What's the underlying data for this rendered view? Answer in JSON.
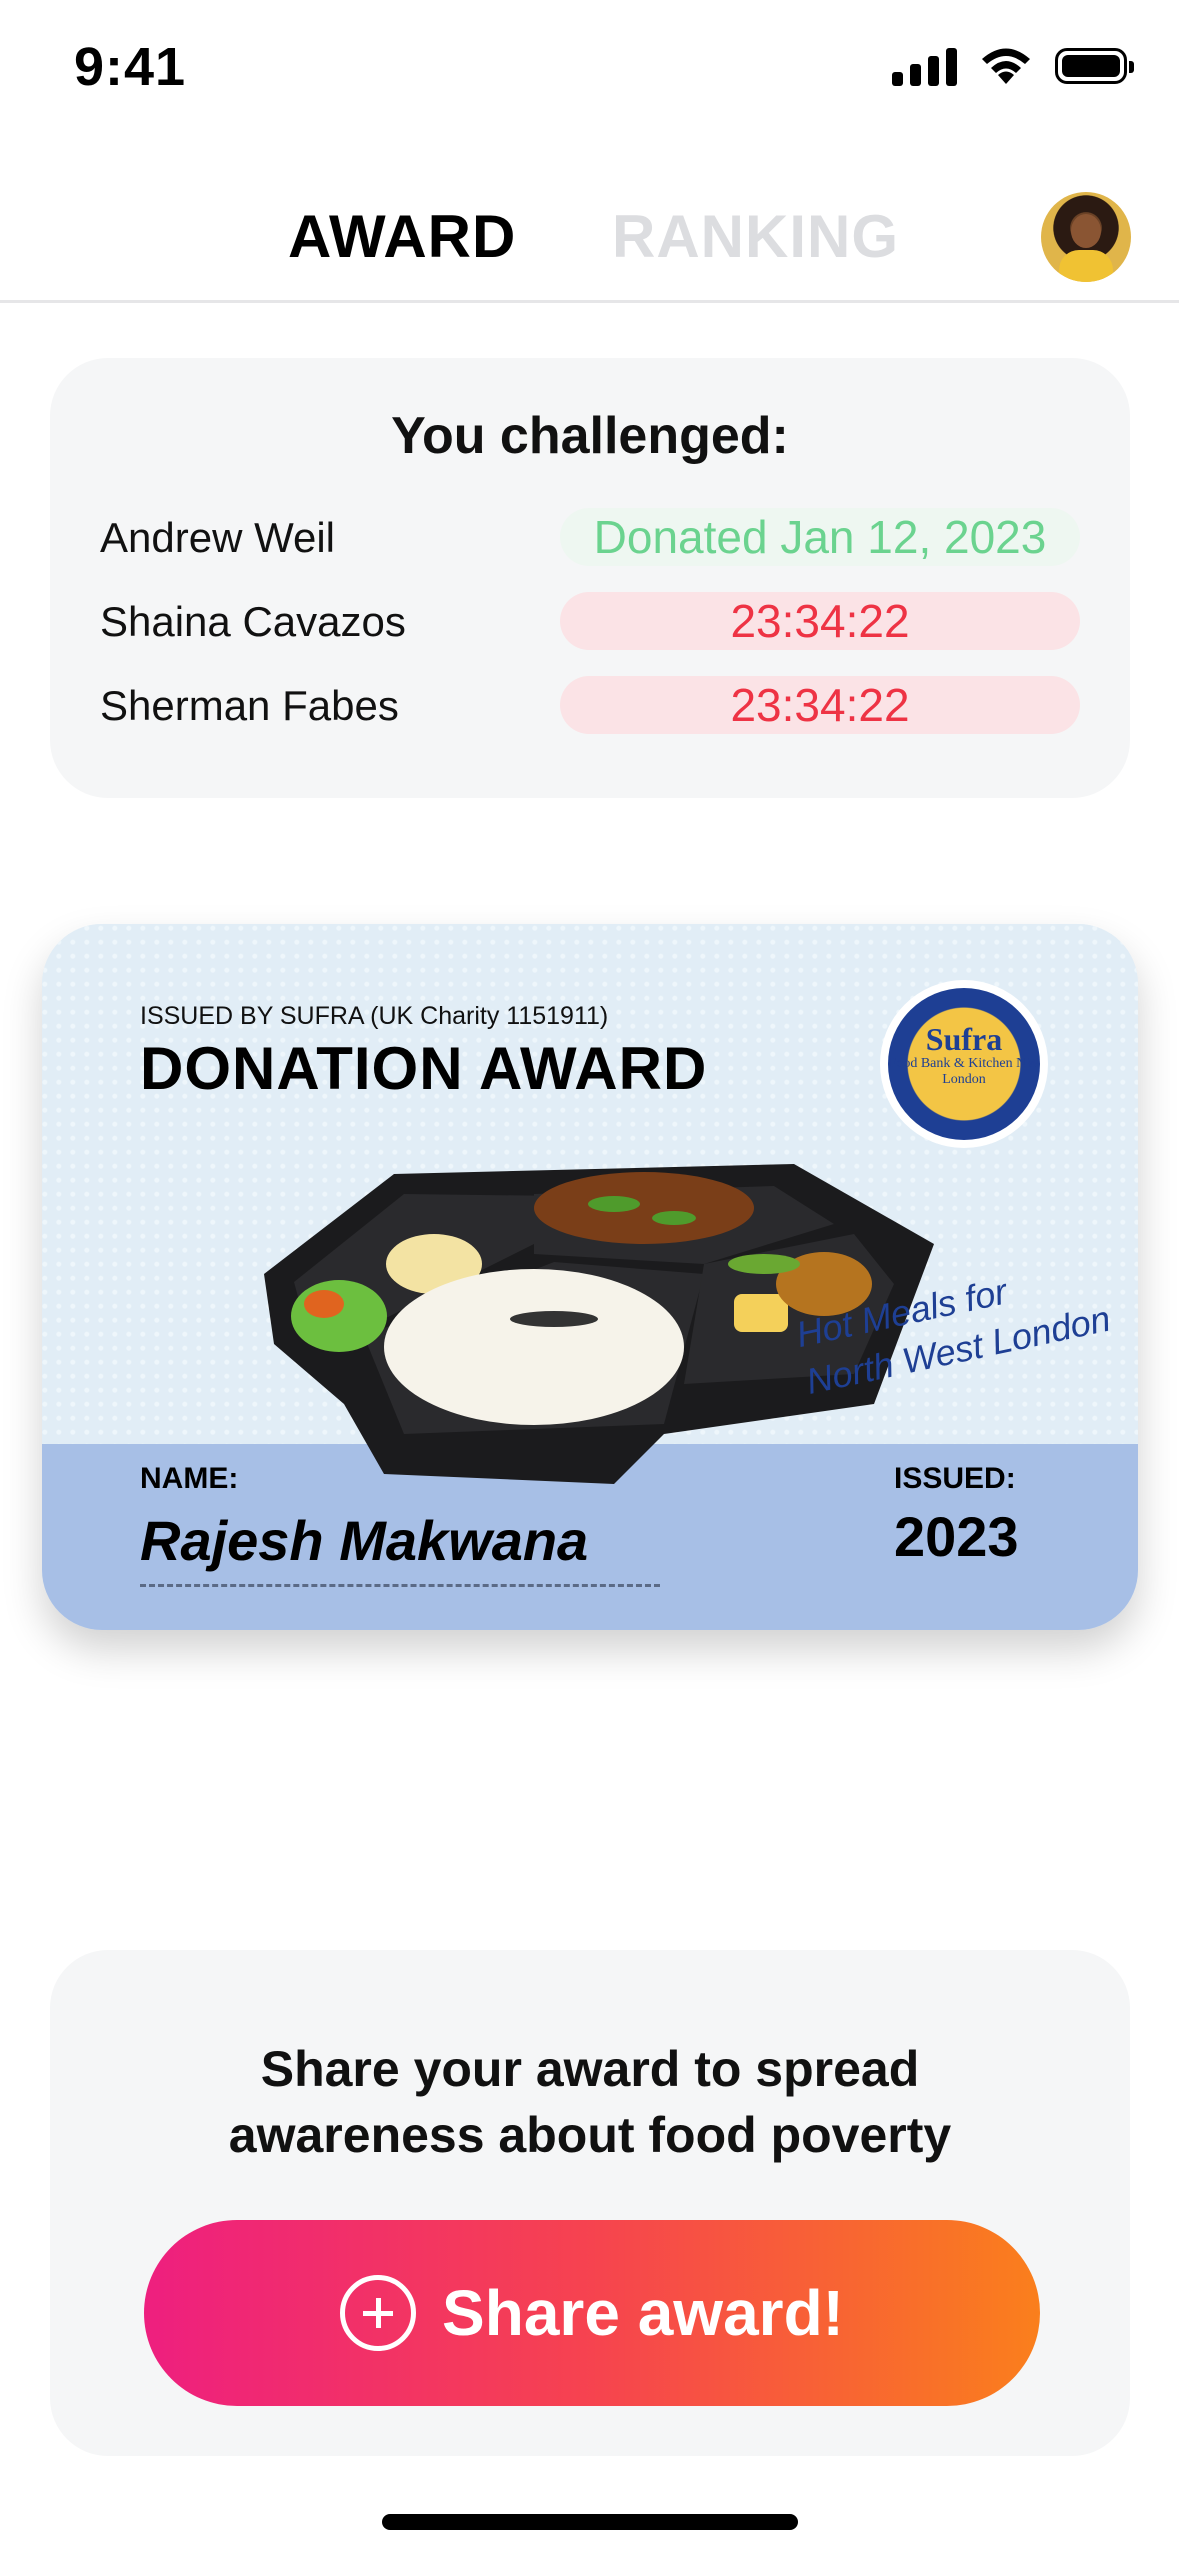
{
  "status": {
    "time": "9:41"
  },
  "tabs": [
    {
      "label": "AWARD",
      "active": true
    },
    {
      "label": "RANKING",
      "active": false
    }
  ],
  "challenge": {
    "title": "You challenged:",
    "rows": [
      {
        "name": "Andrew Weil",
        "status": "Donated Jan 12, 2023",
        "state": "done"
      },
      {
        "name": "Shaina Cavazos",
        "status": "23:34:22",
        "state": "pending"
      },
      {
        "name": "Sherman Fabes",
        "status": "23:34:22",
        "state": "pending"
      }
    ]
  },
  "award": {
    "issued_by": "ISSUED BY SUFRA (UK Charity 1151911)",
    "title": "DONATION AWARD",
    "logo_title": "Sufra",
    "logo_sub": "Food Bank & Kitchen NW London",
    "tagline_line1": "Hot Meals for",
    "tagline_line2": "North West London",
    "name_label": "NAME:",
    "name_value": "Rajesh Makwana",
    "issued_label": "ISSUED:",
    "issued_value": "2023"
  },
  "share": {
    "message_line1": "Share your award to spread",
    "message_line2": "awareness about food poverty",
    "button_label": "Share award!"
  },
  "colors": {
    "accent_start": "#ee1f7f",
    "accent_end": "#fa7f1c",
    "done_green": "#6bd38f",
    "pending_red": "#ee3344",
    "award_band": "#a7bfe6"
  }
}
